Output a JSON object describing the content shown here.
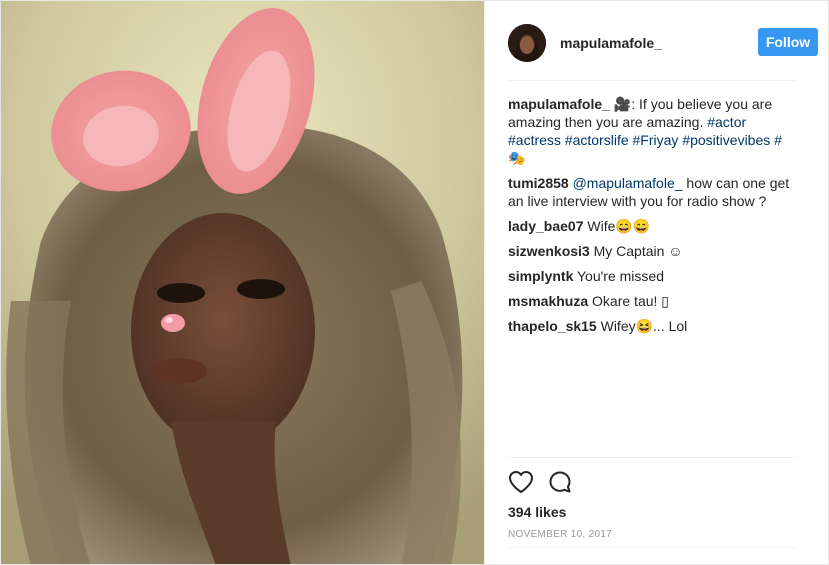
{
  "post": {
    "username": "mapulamafole_",
    "follow_label": "Follow",
    "caption": {
      "user": "mapulamafole_",
      "text": " 🎥: If you believe you are amazing then you are amazing. ",
      "tags": [
        "#actor",
        "#actress",
        "#actorslife",
        "#Friyay",
        "#positivevibes",
        "#🎭"
      ]
    },
    "comments": [
      {
        "user": "tumi2858",
        "mention": "@mapulamafole_",
        "text": " how can one get an live interview with you for radio show ?"
      },
      {
        "user": "lady_bae07",
        "mention": "",
        "text": " Wife😄😄"
      },
      {
        "user": "sizwenkosi3",
        "mention": "",
        "text": " My Captain ☺"
      },
      {
        "user": "simplyntk",
        "mention": "",
        "text": " You're missed"
      },
      {
        "user": "msmakhuza",
        "mention": "",
        "text": " Okare tau! ▯"
      },
      {
        "user": "thapelo_sk15",
        "mention": "",
        "text": " Wifey😆... Lol"
      }
    ],
    "likes": "394 likes",
    "date": "NOVEMBER 10, 2017"
  },
  "icons": {
    "like": "heart-icon",
    "comment": "comment-icon"
  },
  "colors": {
    "accent": "#3897f0",
    "link": "#003569",
    "text": "#262626",
    "muted": "#999999"
  }
}
